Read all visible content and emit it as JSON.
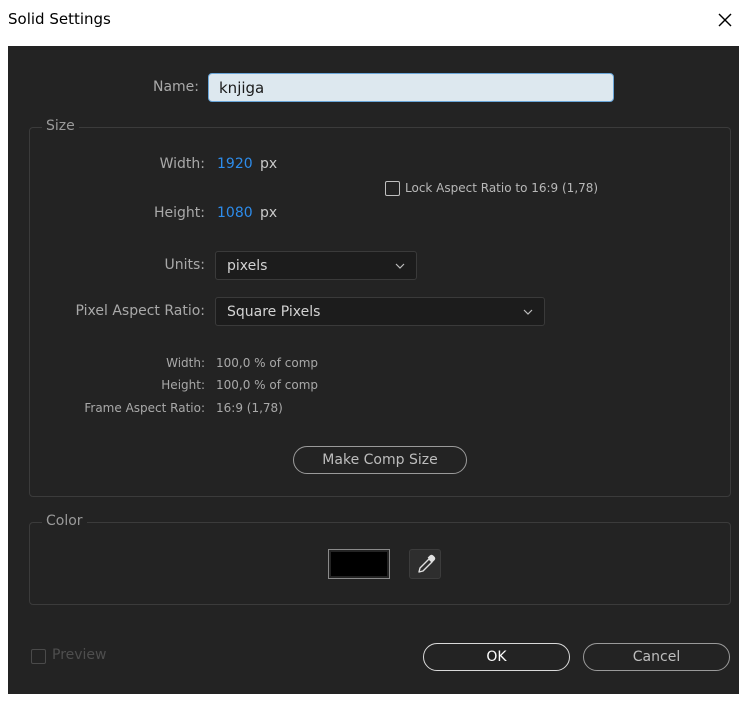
{
  "window": {
    "title": "Solid Settings",
    "close_symbol": "×"
  },
  "name": {
    "label": "Name:",
    "value": "knjiga"
  },
  "size": {
    "legend": "Size",
    "width_label": "Width:",
    "width_value": "1920",
    "width_unit": "px",
    "height_label": "Height:",
    "height_value": "1080",
    "height_unit": "px",
    "lock_aspect_label": "Lock Aspect Ratio to 16:9 (1,78)",
    "lock_aspect_checked": false,
    "units_label": "Units:",
    "units_value": "pixels",
    "par_label": "Pixel Aspect Ratio:",
    "par_value": "Square Pixels",
    "info": {
      "width_label": "Width:",
      "width_value": "100,0 % of comp",
      "height_label": "Height:",
      "height_value": "100,0 % of comp",
      "frame_ar_label": "Frame Aspect Ratio:",
      "frame_ar_value": "16:9 (1,78)"
    },
    "make_comp_size_label": "Make Comp Size"
  },
  "color": {
    "legend": "Color",
    "swatch_hex": "#000000"
  },
  "footer": {
    "preview_label": "Preview",
    "preview_checked": false,
    "ok_label": "OK",
    "cancel_label": "Cancel"
  },
  "theme": {
    "dialog_bg": "#232323",
    "accent_blue": "#2d8ceb",
    "input_bg": "#dde8ef"
  }
}
